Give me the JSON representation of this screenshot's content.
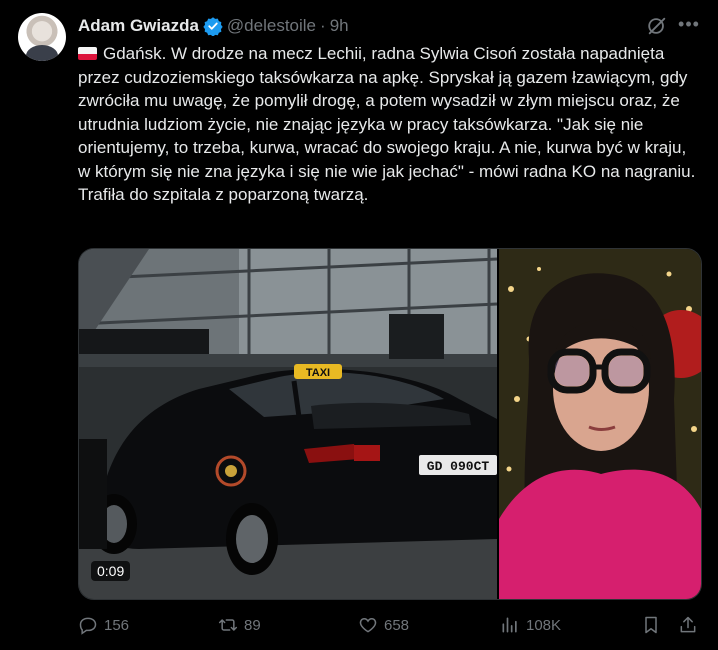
{
  "author": {
    "name": "Adam Gwiazda",
    "handle": "@delestoile",
    "separator": "·",
    "time": "9h",
    "verified": true
  },
  "post": {
    "flag": "Poland",
    "text": "Gdańsk. W drodze na mecz Lechii, radna Sylwia Cisoń została napadnięta przez cudzoziemskiego taksówkarza na apkę. Spryskał ją gazem łzawiącym, gdy zwróciła mu uwagę, że pomylił drogę, a potem wysadził w złym miejscu oraz, że utrudnia ludziom życie, nie znając języka w pracy taksówkarza. \"Jak się nie orientujemy, to trzeba, kurwa, wracać do swojego kraju. A nie, kurwa być w kraju, w którym się nie zna języka i się nie wie jak jechać\" - mówi radna KO na nagraniu. Trafiła do szpitala z poparzoną twarzą."
  },
  "media": {
    "taxi_sign": "TAXI",
    "plate": "GD 090CT",
    "duration": "0:09"
  },
  "actions": {
    "replies": "156",
    "reposts": "89",
    "likes": "658",
    "views": "108K"
  },
  "colors": {
    "background": "#000000",
    "text": "#e7e9ea",
    "muted": "#71767b",
    "verified": "#1d9bf0"
  }
}
